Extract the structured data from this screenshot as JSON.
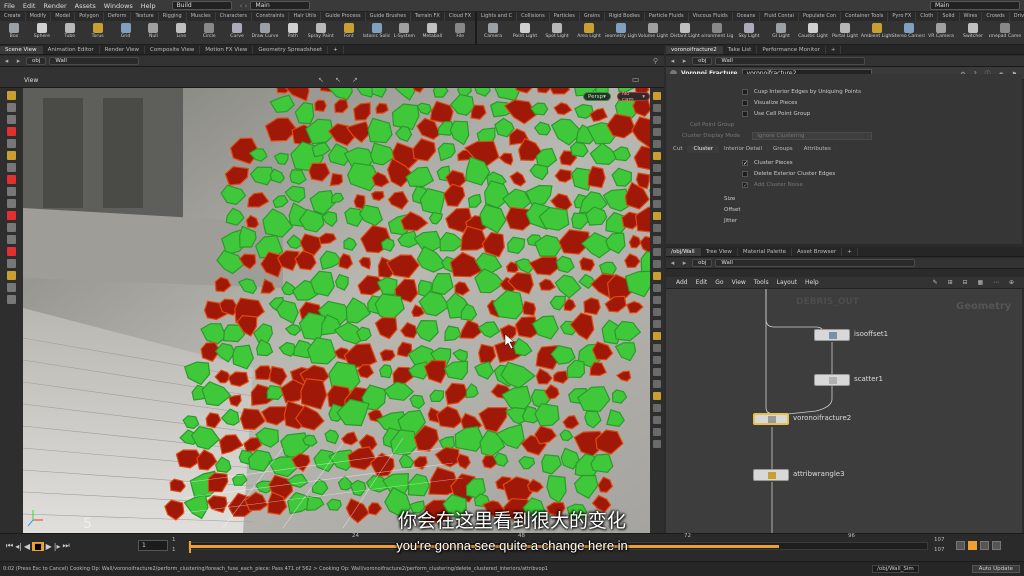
{
  "menubar": {
    "items": [
      "File",
      "Edit",
      "Render",
      "Assets",
      "Windows",
      "Help"
    ],
    "desktop": "Build",
    "context": "Main",
    "right_context": "Main"
  },
  "shelf": {
    "left_tabs": [
      "Create",
      "Modify",
      "Model",
      "Polygon",
      "Deform",
      "Texture",
      "Rigging",
      "Muscles",
      "Characters",
      "Constraints",
      "Hair Utils",
      "Guide Process",
      "Guide Brushes",
      "Terrain FX",
      "Cloud FX",
      "Volume"
    ],
    "right_tabs": [
      "Lights and C",
      "Collisions",
      "Particles",
      "Grains",
      "Rigid Bodies",
      "Particle Fluids",
      "Viscous Fluids",
      "Oceans",
      "Fluid Contai",
      "Populate Con",
      "Container Tools",
      "Pyro FX",
      "Cloth",
      "Solid",
      "Wires",
      "Crowds",
      "Drive Simula"
    ],
    "left_tools": [
      "Box",
      "Sphere",
      "Tube",
      "Torus",
      "Grid",
      "Null",
      "Line",
      "Circle",
      "Curve",
      "Draw Curve",
      "Path",
      "Spray Paint",
      "Font",
      "Platonic Solids",
      "L-System",
      "Metaball",
      "File"
    ],
    "right_tools": [
      "Camera",
      "Point Light",
      "Spot Light",
      "Area Light",
      "Geometry Light",
      "Volume Light",
      "Distant Light",
      "Environment Light",
      "Sky Light",
      "GI Light",
      "Caustic Light",
      "Portal Light",
      "Ambient Light",
      "Stereo Camera",
      "VR Camera",
      "Switcher",
      "Gamepad Camera"
    ]
  },
  "left_pane": {
    "tabs": [
      "Scene View",
      "Animation Editor",
      "Render View",
      "Composite View",
      "Motion FX View",
      "Geometry Spreadsheet"
    ],
    "path": [
      "obj",
      "Wall"
    ],
    "viewport_label": "View",
    "persp": "Persp",
    "cam": "No cam",
    "corner_number": "5"
  },
  "right_top": {
    "tabs": [
      "voronoifracture2",
      "Take List",
      "Performance Monitor"
    ],
    "path": [
      "obj",
      "Wall"
    ],
    "node_type": "Voronoi Fracture",
    "node_name": "voronoifracture2",
    "params_top": [
      {
        "label": "Cusp Interior Edges by Uniquing Points",
        "checked": false
      },
      {
        "label": "Visualize Pieces",
        "checked": false
      },
      {
        "label": "Use Cell Point Group",
        "checked": false
      }
    ],
    "cell_point_group_label": "Cell Point Group",
    "cluster_mode_label": "Cluster Display Mode",
    "cluster_mode_value": "Ignore Clustering",
    "sub_tabs": [
      "Cut",
      "Cluster",
      "Interior Detail",
      "Groups",
      "Attributes"
    ],
    "active_sub_tab": "Cluster",
    "cluster_params": [
      {
        "label": "Cluster Pieces",
        "checked": true
      },
      {
        "label": "Delete Exterior Cluster Edges",
        "checked": false
      },
      {
        "label": "Add Cluster Noise",
        "checked": true
      }
    ],
    "dim_fields": [
      "Size",
      "Offset",
      "Jitter"
    ]
  },
  "right_bottom": {
    "tabs": [
      "/obj/Wall",
      "Tree View",
      "Material Palette",
      "Asset Browser"
    ],
    "path": [
      "obj",
      "Wall"
    ],
    "menu": [
      "Add",
      "Edit",
      "Go",
      "View",
      "Tools",
      "Layout",
      "Help"
    ],
    "watermark": "Geometry",
    "ghost_label": "DEBRIS_OUT",
    "nodes": [
      "isooffset1",
      "scatter1",
      "voronoifracture2",
      "attribwrangle3"
    ]
  },
  "timeline": {
    "frame": "1",
    "start": "1",
    "start2": "1",
    "ticks": [
      "24",
      "48",
      "72",
      "96"
    ],
    "end": "107",
    "end2": "107"
  },
  "status": {
    "text": "0:02 (Press Esc to Cancel) Cooking Op: Wall/voronoifracture2/perform_clustering/foreach_fuse_each_piece: Pass 471 of 562 > Cooking Op: Wall/voronoifracture2/perform_clustering/delete_clustered_interiors/attribvop1",
    "path": "/obj/Wall_Sim",
    "auto_update": "Auto Update"
  },
  "subtitles": {
    "zh": "你会在这里看到很大的变化",
    "en": "you're gonna see quite a change here in"
  },
  "colors": {
    "accent_orange": "#f0a030",
    "node_selected": "#e8c04a",
    "chunk_green": "#3ec83a",
    "chunk_red": "#a01808"
  }
}
